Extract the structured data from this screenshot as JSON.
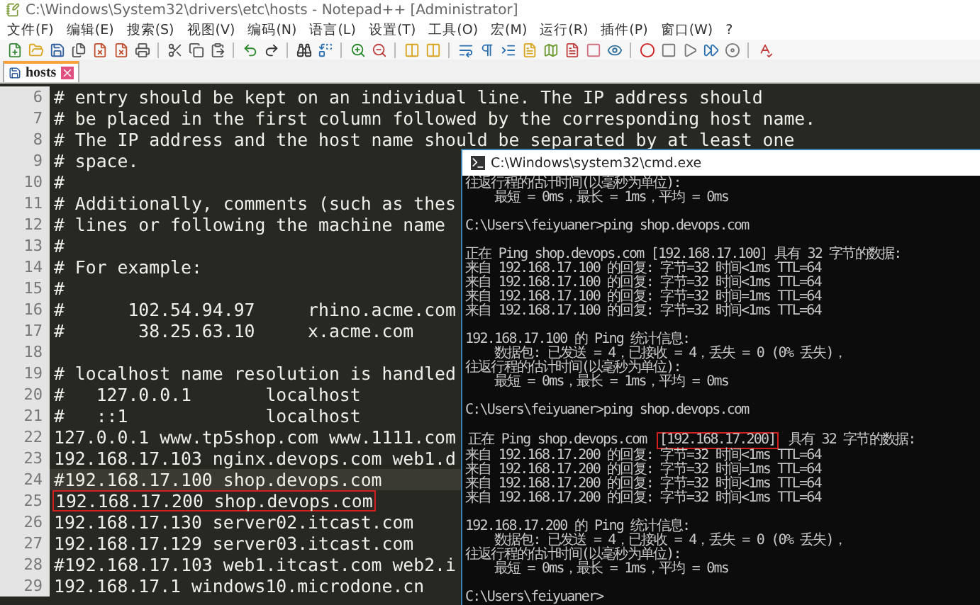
{
  "window": {
    "title": "C:\\Windows\\System32\\drivers\\etc\\hosts - Notepad++ [Administrator]"
  },
  "menu": [
    "文件(F)",
    "编辑(E)",
    "搜索(S)",
    "视图(V)",
    "编码(N)",
    "语言(L)",
    "设置(T)",
    "工具(O)",
    "宏(M)",
    "运行(R)",
    "插件(P)",
    "窗口(W)",
    "?"
  ],
  "tabs": [
    {
      "label": "hosts",
      "selected": true
    }
  ],
  "editor": {
    "lines": [
      {
        "number": "6",
        "text": "# entry should be kept on an individual line. The IP address should",
        "current": false
      },
      {
        "number": "7",
        "text": "# be placed in the first column followed by the corresponding host name.",
        "current": false
      },
      {
        "number": "8",
        "text": "# The IP address and the host name should be separated by at least one",
        "current": false
      },
      {
        "number": "9",
        "text": "# space.",
        "current": false
      },
      {
        "number": "10",
        "text": "#",
        "current": false
      },
      {
        "number": "11",
        "text": "# Additionally, comments (such as thes",
        "current": false
      },
      {
        "number": "12",
        "text": "# lines or following the machine name",
        "current": false
      },
      {
        "number": "13",
        "text": "#",
        "current": false
      },
      {
        "number": "14",
        "text": "# For example:",
        "current": false
      },
      {
        "number": "15",
        "text": "#",
        "current": false
      },
      {
        "number": "16",
        "text": "#      102.54.94.97     rhino.acme.com",
        "current": false
      },
      {
        "number": "17",
        "text": "#       38.25.63.10     x.acme.com",
        "current": false
      },
      {
        "number": "18",
        "current": false
      },
      {
        "number": "19",
        "text": "# localhost name resolution is handled",
        "current": false
      },
      {
        "number": "20",
        "text": "#   127.0.0.1       localhost",
        "current": false
      },
      {
        "number": "21",
        "text": "#   ::1             localhost",
        "current": false
      },
      {
        "number": "22",
        "text": "127.0.0.1 www.tp5shop.com www.1111.com",
        "current": false
      },
      {
        "number": "23",
        "text": "192.168.17.103 nginx.devops.com web1.d",
        "current": false
      },
      {
        "number": "24",
        "text": "#192.168.17.100 shop.devops.com",
        "current": true
      },
      {
        "number": "25",
        "text": "192.168.17.200 shop.devops.com",
        "current": false,
        "boxed": true
      },
      {
        "number": "26",
        "text": "192.168.17.130 server02.itcast.com",
        "current": false
      },
      {
        "number": "27",
        "text": "192.168.17.129 server03.itcast.com",
        "current": false
      },
      {
        "number": "28",
        "text": "#192.168.17.103 web1.itcast.com web2.i",
        "current": false
      },
      {
        "number": "29",
        "text": "192.168.17.1 windows10.microdone.cn",
        "current": false
      }
    ]
  },
  "console": {
    "title": "C:\\Windows\\system32\\cmd.exe",
    "lines": [
      {
        "kind": "text",
        "text": "往返行程的估计时间(以毫秒为单位):"
      },
      {
        "kind": "text",
        "text": "    最短 = 0ms，最长 = 1ms，平均 = 0ms"
      },
      {
        "kind": "blank"
      },
      {
        "kind": "text",
        "text": "C:\\Users\\feiyuaner>ping shop.devops.com"
      },
      {
        "kind": "blank"
      },
      {
        "kind": "text",
        "text": "正在 Ping shop.devops.com [192.168.17.100] 具有 32 字节的数据:"
      },
      {
        "kind": "text",
        "text": "来自 192.168.17.100 的回复: 字节=32 时间<1ms TTL=64"
      },
      {
        "kind": "text",
        "text": "来自 192.168.17.100 的回复: 字节=32 时间<1ms TTL=64"
      },
      {
        "kind": "text",
        "text": "来自 192.168.17.100 的回复: 字节=32 时间=1ms TTL=64"
      },
      {
        "kind": "text",
        "text": "来自 192.168.17.100 的回复: 字节=32 时间<1ms TTL=64"
      },
      {
        "kind": "blank"
      },
      {
        "kind": "text",
        "text": "192.168.17.100 的 Ping 统计信息:"
      },
      {
        "kind": "text",
        "text": "    数据包: 已发送 = 4，已接收 = 4，丢失 = 0 (0% 丢失)，"
      },
      {
        "kind": "text",
        "text": "往返行程的估计时间(以毫秒为单位):"
      },
      {
        "kind": "text",
        "text": "    最短 = 0ms，最长 = 1ms，平均 = 0ms"
      },
      {
        "kind": "blank"
      },
      {
        "kind": "text",
        "text": "C:\\Users\\feiyuaner>ping shop.devops.com"
      },
      {
        "kind": "blank"
      },
      {
        "kind": "segments",
        "segments": [
          {
            "text": "正在 Ping shop.devops.com ",
            "boxed": false
          },
          {
            "text": "[192.168.17.200]",
            "boxed": true
          },
          {
            "text": " 具有 32 字节的数据:",
            "boxed": false
          }
        ]
      },
      {
        "kind": "text",
        "text": "来自 192.168.17.200 的回复: 字节=32 时间<1ms TTL=64"
      },
      {
        "kind": "text",
        "text": "来自 192.168.17.200 的回复: 字节=32 时间=1ms TTL=64"
      },
      {
        "kind": "text",
        "text": "来自 192.168.17.200 的回复: 字节=32 时间<1ms TTL=64"
      },
      {
        "kind": "text",
        "text": "来自 192.168.17.200 的回复: 字节=32 时间<1ms TTL=64"
      },
      {
        "kind": "blank"
      },
      {
        "kind": "text",
        "text": "192.168.17.200 的 Ping 统计信息:"
      },
      {
        "kind": "text",
        "text": "    数据包: 已发送 = 4，已接收 = 4，丢失 = 0 (0% 丢失)，"
      },
      {
        "kind": "text",
        "text": "往返行程的估计时间(以毫秒为单位):"
      },
      {
        "kind": "text",
        "text": "    最短 = 0ms，最长 = 1ms，平均 = 0ms"
      },
      {
        "kind": "blank"
      },
      {
        "kind": "text",
        "text": "C:\\Users\\feiyuaner>"
      }
    ]
  }
}
